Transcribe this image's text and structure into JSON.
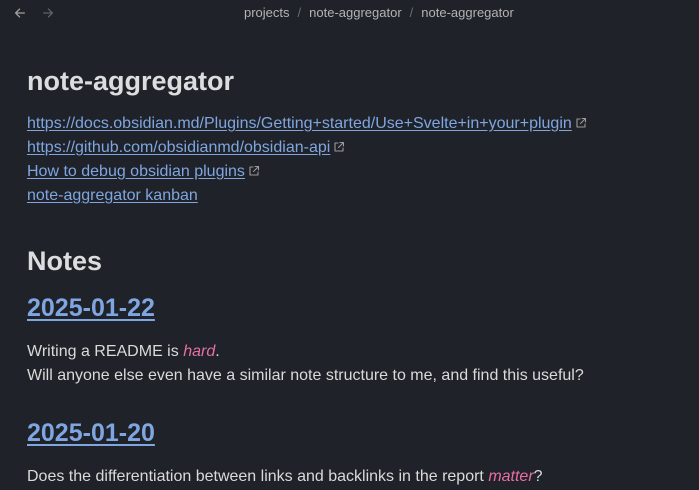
{
  "breadcrumb": [
    "projects",
    "note-aggregator",
    "note-aggregator"
  ],
  "page_title": "note-aggregator",
  "links": [
    {
      "text": "https://docs.obsidian.md/Plugins/Getting+started/Use+Svelte+in+your+plugin",
      "external": true
    },
    {
      "text": "https://github.com/obsidianmd/obsidian-api",
      "external": true
    },
    {
      "text": "How to debug obsidian plugins",
      "external": true
    },
    {
      "text": "note-aggregator kanban",
      "external": false
    }
  ],
  "notes_heading": "Notes",
  "notes": [
    {
      "date": "2025-01-22",
      "line1_before": "Writing a README is ",
      "line1_em": "hard",
      "line1_after": ".",
      "line2": "Will anyone else even have a similar note structure to me, and find this useful?"
    },
    {
      "date": "2025-01-20",
      "line1_before": "Does the differentiation between links and backlinks in the report ",
      "line1_em": "matter",
      "line1_after": "?"
    }
  ],
  "colors": {
    "background": "#1f2228",
    "link": "#7fa6e0",
    "emphasis": "#e76fa4"
  },
  "icons": {
    "back": "arrow-left-icon",
    "forward": "arrow-right-icon",
    "external": "external-link-icon"
  }
}
